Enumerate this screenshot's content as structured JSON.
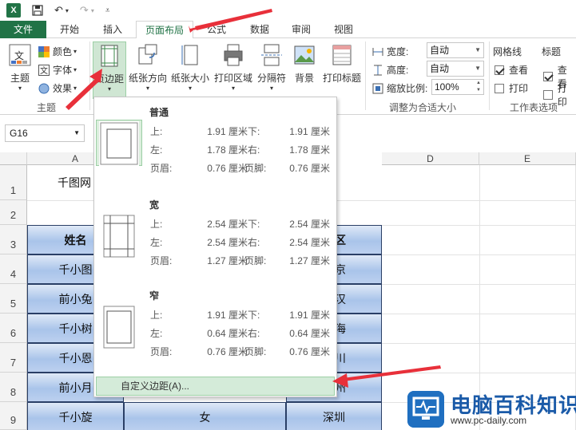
{
  "qat": {
    "logo": "X",
    "undo": "↶",
    "redo": "↷"
  },
  "tabs": [
    "文件",
    "开始",
    "插入",
    "页面布局",
    "公式",
    "数据",
    "审阅",
    "视图"
  ],
  "ribbon": {
    "theme_group": {
      "themes": "主题",
      "colors": "颜色",
      "fonts": "字体",
      "effects": "效果",
      "label": "主题"
    },
    "page_setup": {
      "margins": "页边距",
      "orientation": "纸张方向",
      "size": "纸张大小",
      "print_area": "打印区域",
      "breaks": "分隔符",
      "background": "背景",
      "print_titles": "打印标题"
    },
    "scale_to_fit": {
      "width_label": "宽度:",
      "width_value": "自动",
      "height_label": "高度:",
      "height_value": "自动",
      "scale_label": "缩放比例:",
      "scale_value": "100%",
      "label": "调整为合适大小"
    },
    "sheet_options": {
      "gridlines": "网格线",
      "headings": "标题",
      "view": "查看",
      "print": "打印",
      "label": "工作表选项"
    }
  },
  "namebox": {
    "value": "G16"
  },
  "sheet": {
    "columns": [
      "A",
      "D",
      "E"
    ],
    "rows": [
      "1",
      "2",
      "3",
      "4",
      "5",
      "6",
      "7",
      "8",
      "9"
    ],
    "a1": "千图网",
    "a3": "姓名",
    "names": [
      "千小图",
      "前小兔",
      "千小树",
      "千小恩",
      "前小月",
      "千小旋"
    ],
    "c3": "区",
    "c_col": [
      "京",
      "汉",
      "海",
      "川",
      "州"
    ],
    "b9": "女",
    "c9": "深圳"
  },
  "margins_menu": {
    "presets": [
      {
        "name": "普通",
        "top_l": "上:",
        "top_v": "1.91 厘米",
        "bottom_l": "下:",
        "bottom_v": "1.91 厘米",
        "left_l": "左:",
        "left_v": "1.78 厘米",
        "right_l": "右:",
        "right_v": "1.78 厘米",
        "header_l": "页眉:",
        "header_v": "0.76 厘米",
        "footer_l": "页脚:",
        "footer_v": "0.76 厘米"
      },
      {
        "name": "宽",
        "top_l": "上:",
        "top_v": "2.54 厘米",
        "bottom_l": "下:",
        "bottom_v": "2.54 厘米",
        "left_l": "左:",
        "left_v": "2.54 厘米",
        "right_l": "右:",
        "right_v": "2.54 厘米",
        "header_l": "页眉:",
        "header_v": "1.27 厘米",
        "footer_l": "页脚:",
        "footer_v": "1.27 厘米"
      },
      {
        "name": "窄",
        "top_l": "上:",
        "top_v": "1.91 厘米",
        "bottom_l": "下:",
        "bottom_v": "1.91 厘米",
        "left_l": "左:",
        "left_v": "0.64 厘米",
        "right_l": "右:",
        "right_v": "0.64 厘米",
        "header_l": "页眉:",
        "header_v": "0.76 厘米",
        "footer_l": "页脚:",
        "footer_v": "0.76 厘米"
      }
    ],
    "custom": "自定义边距(A)..."
  },
  "watermark": {
    "title": "电脑百科知识",
    "url": "www.pc-daily.com"
  },
  "colors": {
    "excel_green": "#217346",
    "annotation_red": "#e8303a",
    "header_blue": "#a9c4ea",
    "selected_green": "#d4ebd9"
  }
}
